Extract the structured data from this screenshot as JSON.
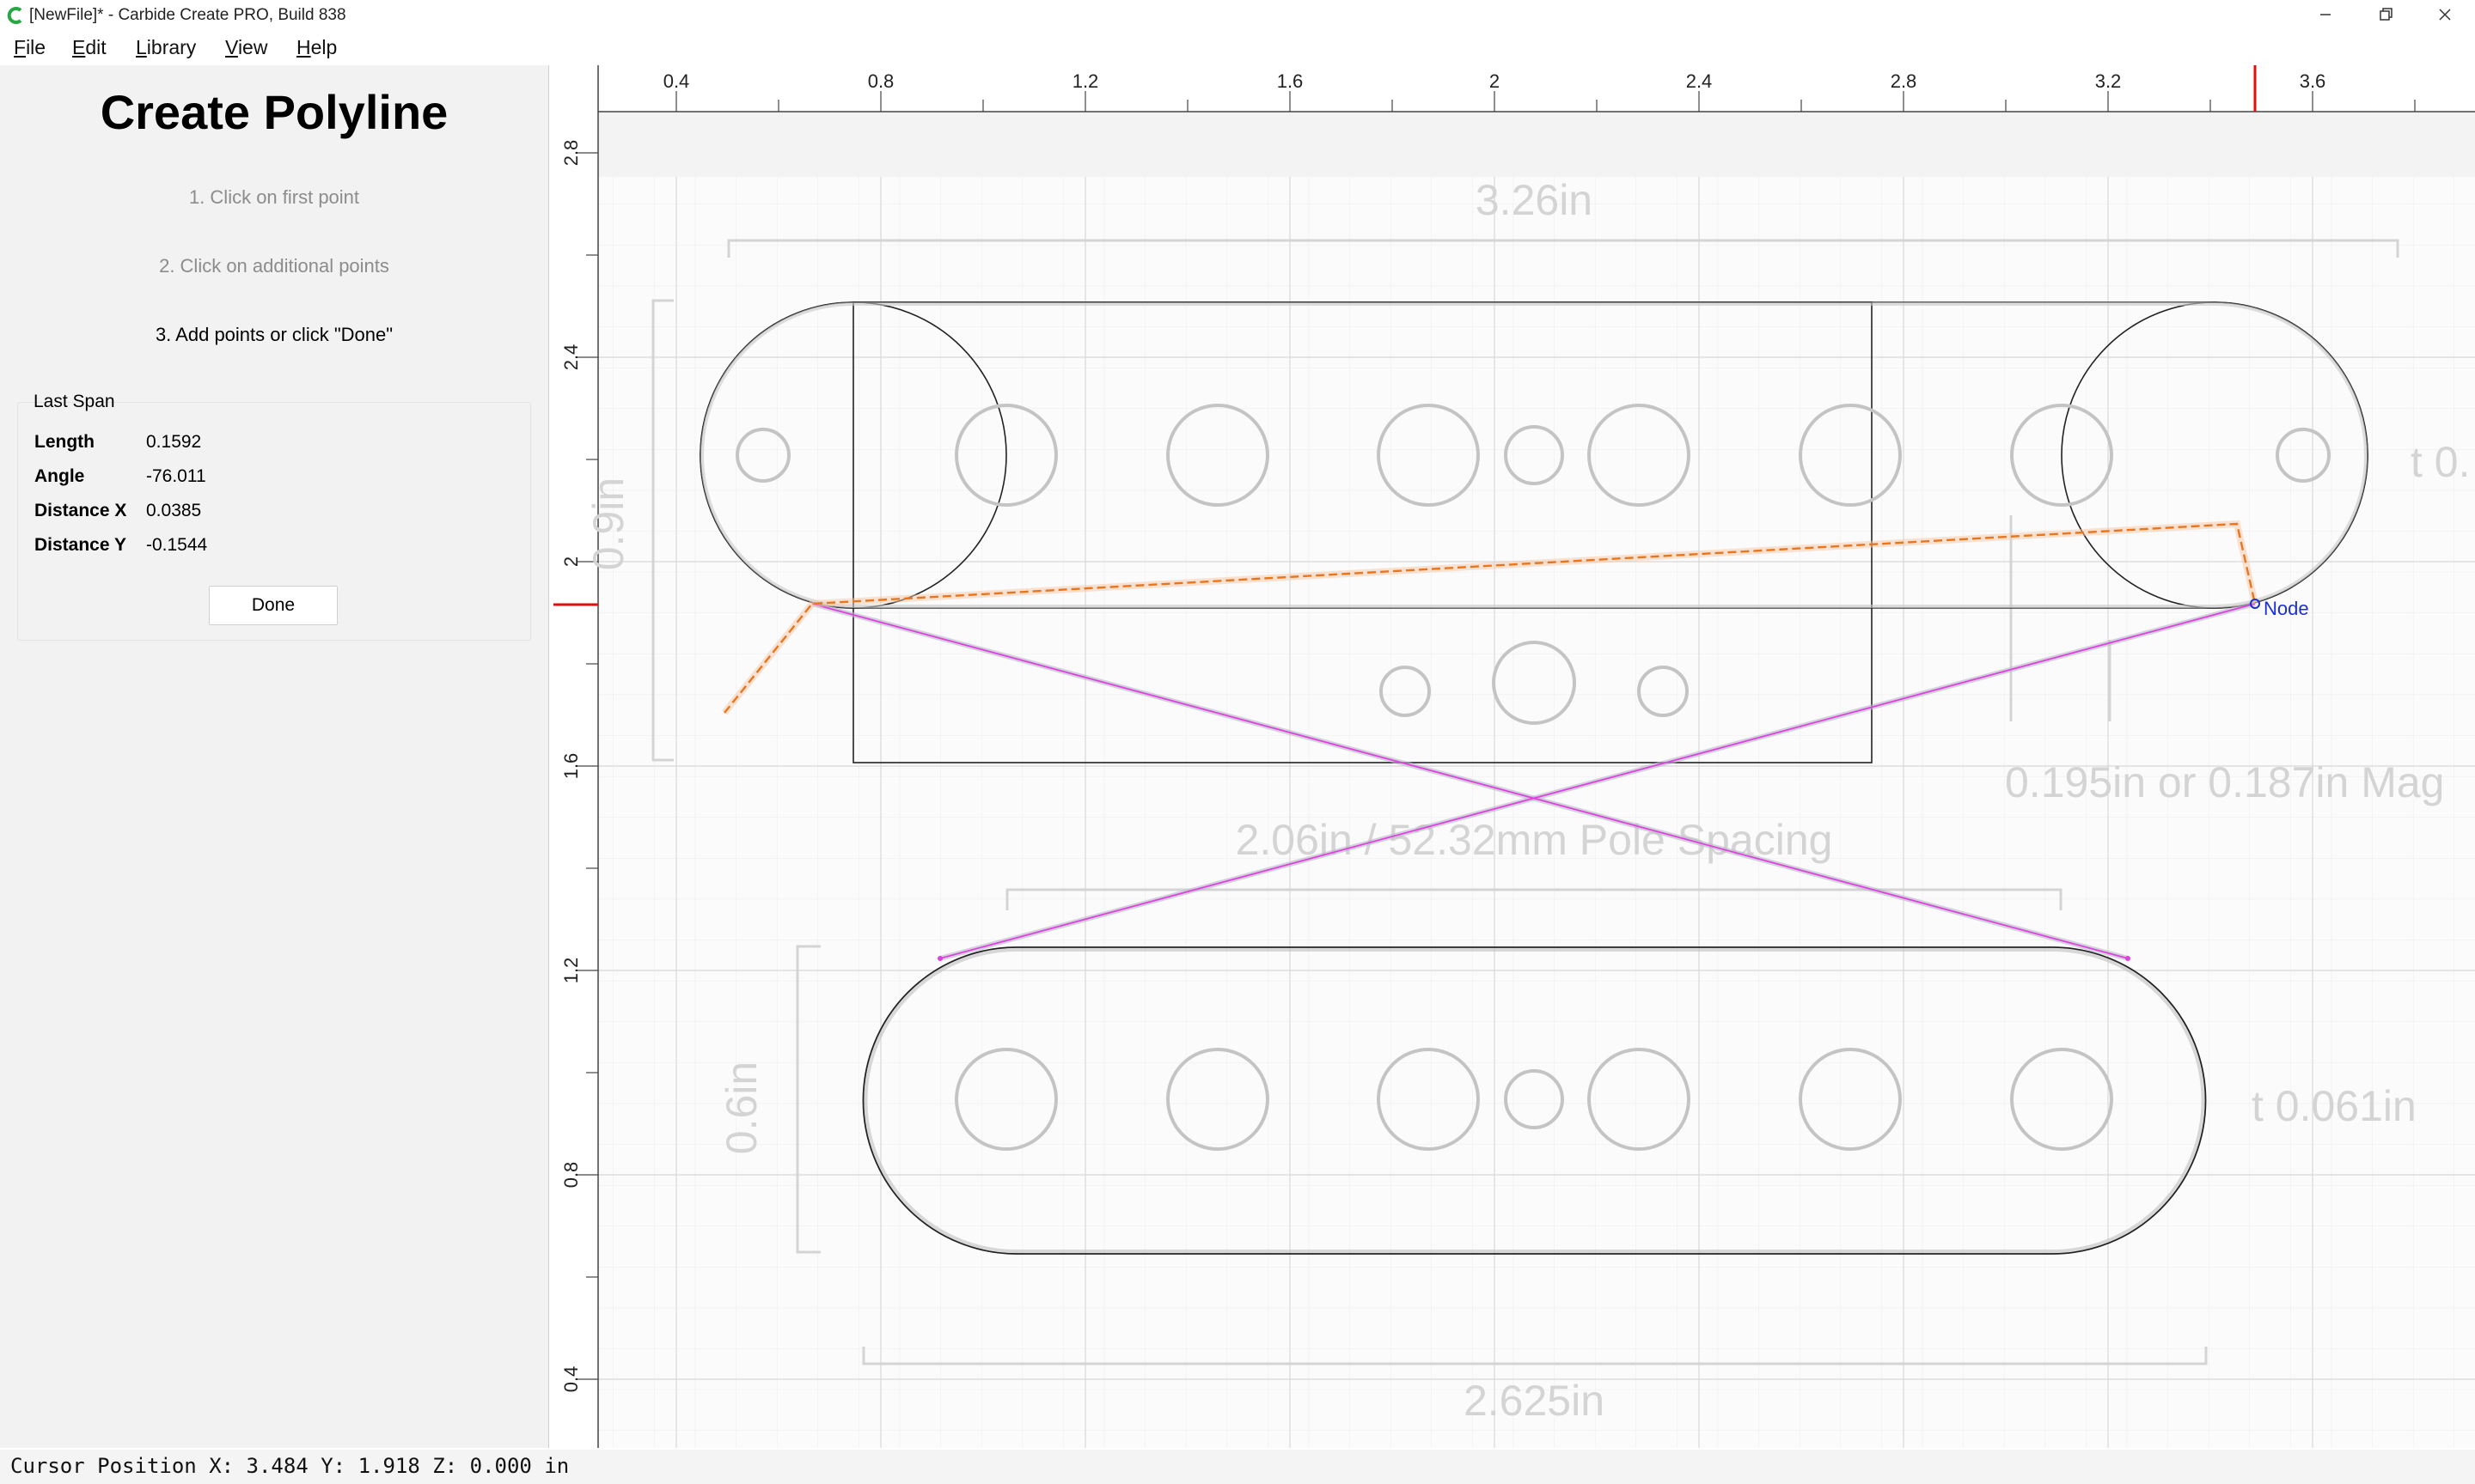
{
  "window": {
    "title": "[NewFile]* - Carbide Create PRO, Build 838",
    "controls": [
      "minimize-icon",
      "restore-icon",
      "close-icon"
    ]
  },
  "menu": {
    "items": [
      {
        "label": "File",
        "accel": "F",
        "rest": "ile"
      },
      {
        "label": "Edit",
        "accel": "E",
        "rest": "dit"
      },
      {
        "label": "Library",
        "accel": "L",
        "rest": "ibrary"
      },
      {
        "label": "View",
        "accel": "V",
        "rest": "iew"
      },
      {
        "label": "Help",
        "accel": "H",
        "rest": "elp"
      }
    ]
  },
  "panel": {
    "title": "Create Polyline",
    "steps": [
      "1. Click on first point",
      "2. Click on additional points",
      "3. Add points or click \"Done\""
    ],
    "group_label": "Last Span",
    "rows": [
      {
        "label": "Length",
        "value": "0.1592"
      },
      {
        "label": "Angle",
        "value": "-76.011"
      },
      {
        "label": "Distance X",
        "value": "0.0385"
      },
      {
        "label": "Distance Y",
        "value": "-0.1544"
      }
    ],
    "done_label": "Done"
  },
  "rulers": {
    "x_labels": [
      "0.4",
      "0.8",
      "1.2",
      "1.6",
      "2",
      "2.4",
      "2.8",
      "3.2",
      "3.6"
    ],
    "y_labels": [
      "2.8",
      "2.4",
      "2",
      "1.6",
      "1.2",
      "0.8",
      "0.4"
    ]
  },
  "canvas": {
    "dimension_labels": {
      "top_width": "3.26in",
      "top_height": "0.9in",
      "top_thickness": "t 0.",
      "magnet": "0.195in or 0.187in Mag",
      "pole_spacing": "2.06in / 52.32mm Pole Spacing",
      "bottom_height": "0.6in",
      "bottom_thickness": "t 0.061in",
      "bottom_width": "2.625in"
    },
    "node_label": "Node",
    "colors": {
      "grid": "#e6e6e6",
      "polyline": "#e8761e",
      "tangent_lines": "#e040e0",
      "node": "#1b2fd6",
      "cursor_marker": "#e01010"
    }
  },
  "status": {
    "text": "Cursor Position X: 3.484 Y: 1.918 Z: 0.000 in"
  }
}
